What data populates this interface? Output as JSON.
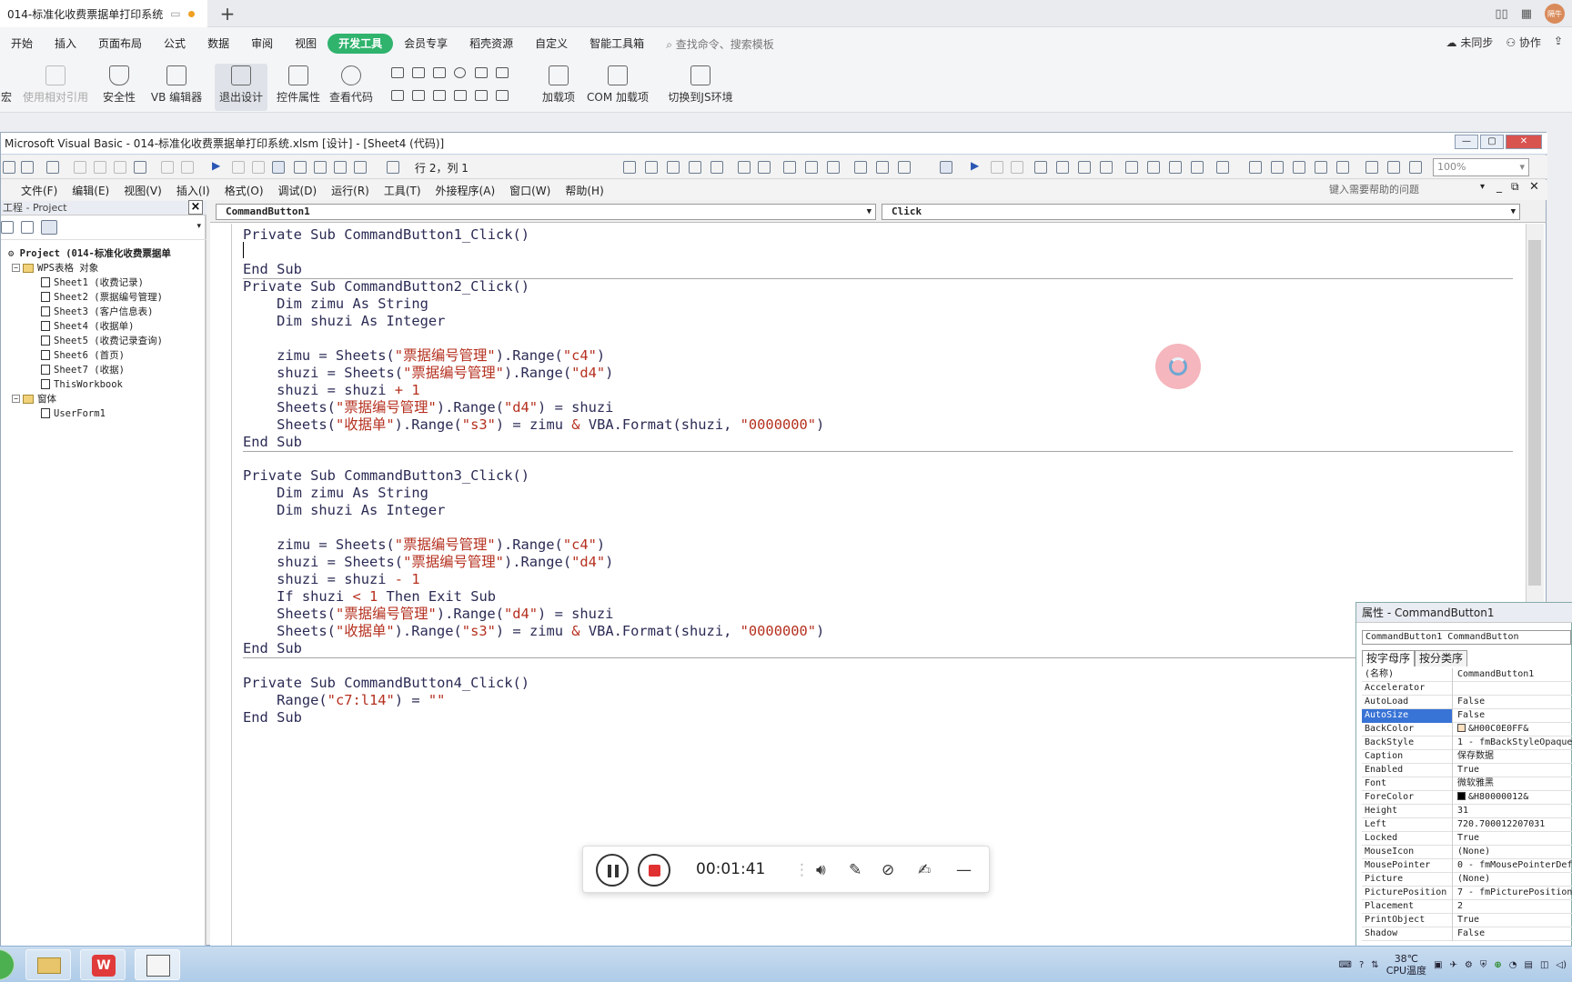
{
  "wps": {
    "doc_tab_title": "014-标准化收费票据单打印系统",
    "ribbon_tabs": [
      "开始",
      "插入",
      "页面布局",
      "公式",
      "数据",
      "审阅",
      "视图",
      "开发工具",
      "会员专享",
      "稻壳资源",
      "自定义",
      "智能工具箱"
    ],
    "active_tab": "开发工具",
    "search_placeholder": "查找命令、搜索模板",
    "sync_label": "未同步",
    "collab_label": "协作",
    "avatar_text": "隔牛",
    "tools": {
      "macro": "宏",
      "relative_ref": "使用相对引用",
      "security": "安全性",
      "vb_editor": "VB 编辑器",
      "exit_design": "退出设计",
      "control_props": "控件属性",
      "view_code": "查看代码",
      "addins": "加载项",
      "com_addins": "COM 加载项",
      "js_env": "切换到JS环境"
    }
  },
  "vba": {
    "title": "Microsoft Visual Basic - 014-标准化收费票据单打印系统.xlsm [设计] - [Sheet4 (代码)]",
    "cursor_pos": "行 2，列 1",
    "zoom": "100%",
    "menu": [
      "文件(F)",
      "编辑(E)",
      "视图(V)",
      "插入(I)",
      "格式(O)",
      "调试(D)",
      "运行(R)",
      "工具(T)",
      "外接程序(A)",
      "窗口(W)",
      "帮助(H)"
    ],
    "help_placeholder": "键入需要帮助的问题",
    "project": {
      "title": "工程 - Project",
      "root": "Project (014-标准化收费票据单",
      "group1": "WPS表格 对象",
      "items": [
        "Sheet1 (收费记录)",
        "Sheet2 (票据编号管理)",
        "Sheet3 (客户信息表)",
        "Sheet4 (收据单)",
        "Sheet5 (收费记录查询)",
        "Sheet6 (首页)",
        "Sheet7 (收据)",
        "ThisWorkbook"
      ],
      "group2": "窗体",
      "forms": [
        "UserForm1"
      ]
    },
    "object_combo": "CommandButton1",
    "proc_combo": "Click",
    "code": {
      "s1": [
        "Private Sub CommandButton1_Click()",
        "",
        "End Sub"
      ],
      "s2": {
        "l0": "Private Sub CommandButton2_Click()",
        "l1": "    Dim zimu As String",
        "l2": "    Dim shuzi As Integer",
        "l4a": "    zimu = Sheets(",
        "l4s1": "\"票据编号管理\"",
        "l4b": ").Range(",
        "l4s2": "\"c4\"",
        "l4c": ")",
        "l5a": "    shuzi = Sheets(",
        "l5s1": "\"票据编号管理\"",
        "l5b": ").Range(",
        "l5s2": "\"d4\"",
        "l5c": ")",
        "l6a": "    shuzi = shuzi ",
        "l6s": "+ 1",
        "l7a": "    Sheets(",
        "l7s1": "\"票据编号管理\"",
        "l7b": ").Range(",
        "l7s2": "\"d4\"",
        "l7c": ") = shuzi",
        "l8a": "    Sheets(",
        "l8s1": "\"收据单\"",
        "l8b": ").Range(",
        "l8s2": "\"s3\"",
        "l8c": ") = zimu ",
        "l8d": "&",
        "l8e": " VBA.Format(shuzi, ",
        "l8s3": "\"0000000\"",
        "l8f": ")",
        "l9": "End Sub"
      },
      "s3": {
        "l0": "Private Sub CommandButton3_Click()",
        "l1": "    Dim zimu As String",
        "l2": "    Dim shuzi As Integer",
        "l4a": "    zimu = Sheets(",
        "l4s1": "\"票据编号管理\"",
        "l4b": ").Range(",
        "l4s2": "\"c4\"",
        "l4c": ")",
        "l5a": "    shuzi = Sheets(",
        "l5s1": "\"票据编号管理\"",
        "l5b": ").Range(",
        "l5s2": "\"d4\"",
        "l5c": ")",
        "l6a": "    shuzi = shuzi ",
        "l6s": "- 1",
        "l7a": "    If shuzi ",
        "l7s": "< 1",
        "l7b": " Then Exit Sub",
        "l8a": "    Sheets(",
        "l8s1": "\"票据编号管理\"",
        "l8b": ").Range(",
        "l8s2": "\"d4\"",
        "l8c": ") = shuzi",
        "l9a": "    Sheets(",
        "l9s1": "\"收据单\"",
        "l9b": ").Range(",
        "l9s2": "\"s3\"",
        "l9c": ") = zimu ",
        "l9d": "&",
        "l9e": " VBA.Format(shuzi, ",
        "l9s3": "\"0000000\"",
        "l9f": ")",
        "l10": "End Sub"
      },
      "s4": {
        "l0": "Private Sub CommandButton4_Click()",
        "l1a": "    Range(",
        "l1s1": "\"c7:l14\"",
        "l1b": ") = ",
        "l1s2": "\"\"",
        "l2": "End Sub"
      }
    }
  },
  "properties": {
    "title": "属性 - CommandButton1",
    "object": "CommandButton1 CommandButton",
    "tabs": [
      "按字母序",
      "按分类序"
    ],
    "rows": [
      {
        "name": "(名称)",
        "value": "CommandButton1"
      },
      {
        "name": "Accelerator",
        "value": ""
      },
      {
        "name": "AutoLoad",
        "value": "False"
      },
      {
        "name": "AutoSize",
        "value": "False"
      },
      {
        "name": "BackColor",
        "value": "&H00C0E0FF&"
      },
      {
        "name": "BackStyle",
        "value": "1 - fmBackStyleOpaque"
      },
      {
        "name": "Caption",
        "value": "保存数据"
      },
      {
        "name": "Enabled",
        "value": "True"
      },
      {
        "name": "Font",
        "value": "微软雅黑"
      },
      {
        "name": "ForeColor",
        "value": "&H80000012&"
      },
      {
        "name": "Height",
        "value": "31"
      },
      {
        "name": "Left",
        "value": "720.700012207031"
      },
      {
        "name": "Locked",
        "value": "True"
      },
      {
        "name": "MouseIcon",
        "value": "(None)"
      },
      {
        "name": "MousePointer",
        "value": "0 - fmMousePointerDefault"
      },
      {
        "name": "Picture",
        "value": "(None)"
      },
      {
        "name": "PicturePosition",
        "value": "7 - fmPicturePositionAboveCenter"
      },
      {
        "name": "Placement",
        "value": "2"
      },
      {
        "name": "PrintObject",
        "value": "True"
      },
      {
        "name": "Shadow",
        "value": "False"
      }
    ],
    "selected": "AutoSize",
    "backcolor_hex": "#FFE0C0",
    "forecolor_hex": "#000000"
  },
  "recorder": {
    "time": "00:01:41"
  },
  "taskbar": {
    "temp": "38℃",
    "cpu_label": "CPU温度"
  },
  "colors": {
    "accent": "#2fb36d",
    "code_text": "#2b2b55",
    "code_string": "#b5301f",
    "selected_row": "#3873d6"
  }
}
